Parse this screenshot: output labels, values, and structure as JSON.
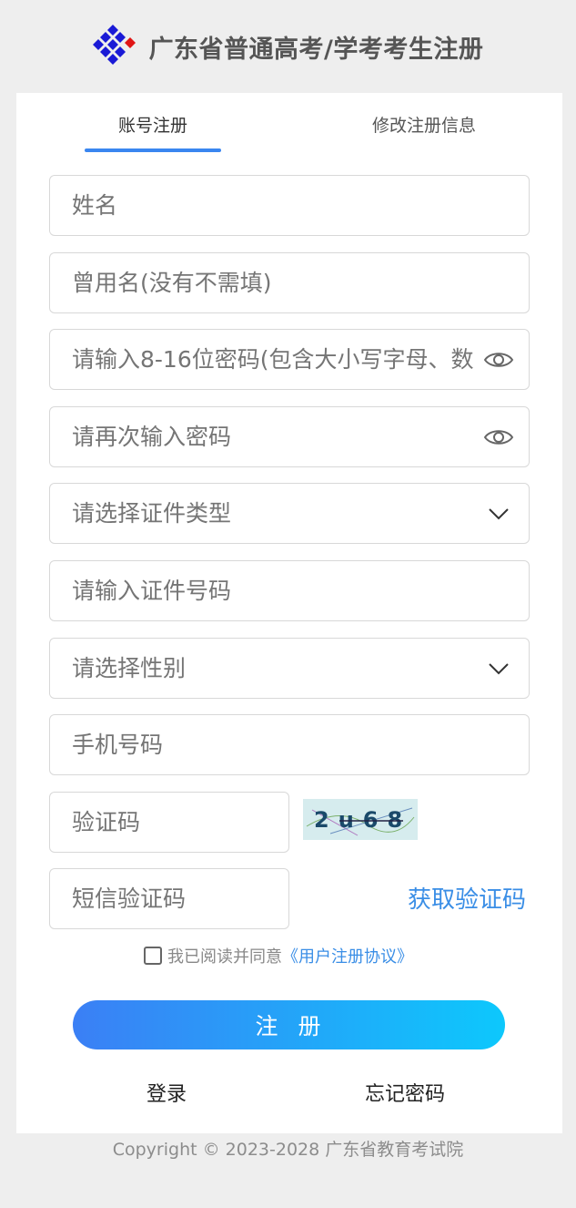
{
  "header": {
    "title": "广东省普通高考/学考考生注册",
    "logo_icon": "diamond-logo-icon"
  },
  "tabs": [
    {
      "label": "账号注册",
      "active": true
    },
    {
      "label": "修改注册信息",
      "active": false
    }
  ],
  "form": {
    "name": {
      "placeholder": "姓名"
    },
    "former_name": {
      "placeholder": "曾用名(没有不需填)"
    },
    "password": {
      "placeholder": "请输入8-16位密码(包含大小写字母、数",
      "icon": "eye-icon"
    },
    "password_confirm": {
      "placeholder": "请再次输入密码",
      "icon": "eye-icon"
    },
    "id_type": {
      "placeholder": "请选择证件类型",
      "icon": "chevron-down-icon"
    },
    "id_number": {
      "placeholder": "请输入证件号码"
    },
    "gender": {
      "placeholder": "请选择性别",
      "icon": "chevron-down-icon"
    },
    "phone": {
      "placeholder": "手机号码"
    },
    "captcha": {
      "placeholder": "验证码",
      "image_text": "2u68"
    },
    "sms_code": {
      "placeholder": "短信验证码"
    },
    "sms_button": "获取验证码"
  },
  "agreement": {
    "prefix": "我已阅读并同意",
    "link": "《用户注册协议》"
  },
  "submit_label": "注  册",
  "links": {
    "login": "登录",
    "forgot": "忘记密码"
  },
  "footer": "Copyright © 2023-2028 广东省教育考试院",
  "colors": {
    "accent": "#3a86f0",
    "link": "#3a8ee6",
    "button_start": "#3b7ff5",
    "button_end": "#0dc8fc",
    "logo_blue": "#1a1ad6",
    "logo_red": "#e01515"
  }
}
